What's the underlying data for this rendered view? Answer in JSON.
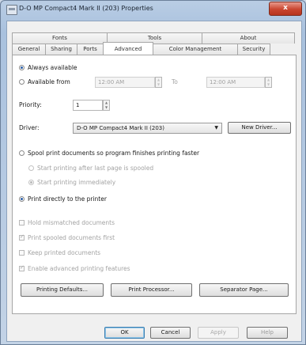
{
  "window": {
    "title": "D-O MP Compact4 Mark II (203) Properties",
    "close_glyph": "x"
  },
  "tabs_back": [
    "Fonts",
    "Tools",
    "About"
  ],
  "tabs_front": [
    "General",
    "Sharing",
    "Ports",
    "Advanced",
    "Color Management",
    "Security"
  ],
  "active_tab": "Advanced",
  "availability": {
    "always_label": "Always available",
    "always_selected": true,
    "from_label": "Available from",
    "from_selected": false,
    "from_time": "12:00 AM",
    "to_label": "To",
    "to_time": "12:00 AM"
  },
  "priority": {
    "label": "Priority:",
    "value": "1"
  },
  "driver": {
    "label": "Driver:",
    "value": "D-O MP Compact4 Mark II (203)",
    "new_driver_label": "New Driver..."
  },
  "spooling": {
    "spool_label": "Spool print documents so program finishes printing faster",
    "spool_selected": false,
    "after_last_page_label": "Start printing after last page is spooled",
    "immediately_label": "Start printing immediately",
    "direct_label": "Print directly to the printer",
    "direct_selected": true
  },
  "options": [
    {
      "label": "Hold mismatched documents",
      "checked": false
    },
    {
      "label": "Print spooled documents first",
      "checked": true
    },
    {
      "label": "Keep printed documents",
      "checked": false
    },
    {
      "label": "Enable advanced printing features",
      "checked": true
    }
  ],
  "panel_buttons": {
    "defaults": "Printing Defaults...",
    "processor": "Print Processor...",
    "separator": "Separator Page..."
  },
  "dialog_buttons": {
    "ok": "OK",
    "cancel": "Cancel",
    "apply": "Apply",
    "help": "Help"
  }
}
